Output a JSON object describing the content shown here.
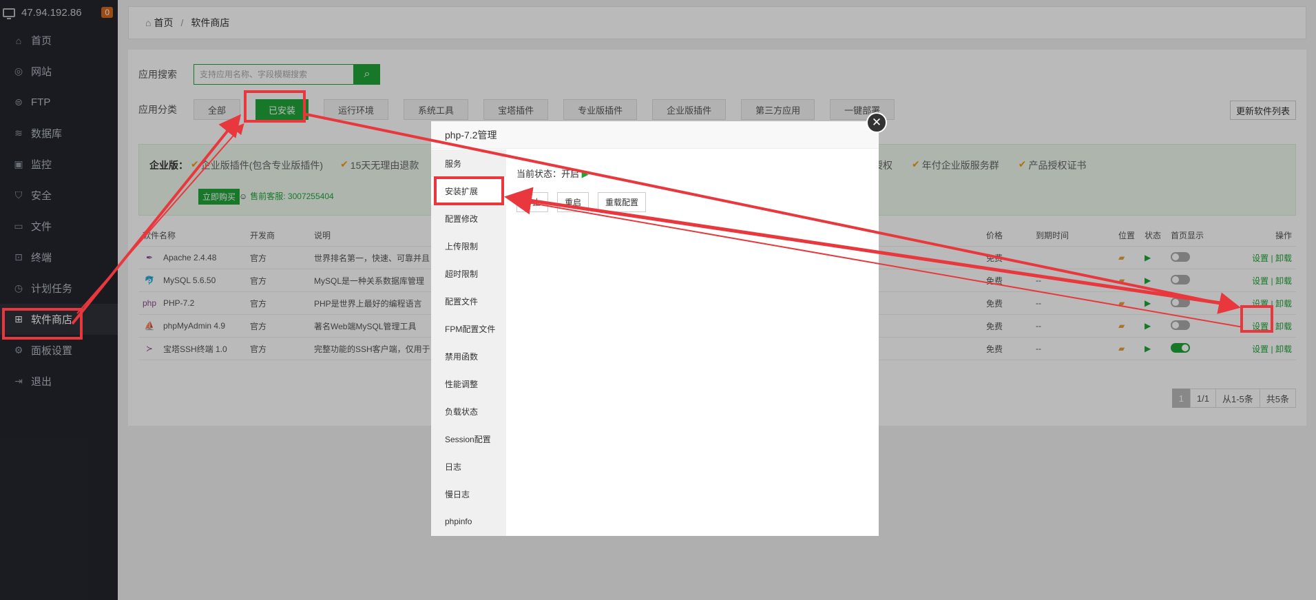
{
  "sidebar": {
    "ip": "47.94.192.86",
    "badge": "0",
    "items": [
      {
        "icon": "home-icon",
        "glyph": "⌂",
        "label": "首页"
      },
      {
        "icon": "globe-icon",
        "glyph": "◎",
        "label": "网站"
      },
      {
        "icon": "ftp-icon",
        "glyph": "⊜",
        "label": "FTP"
      },
      {
        "icon": "database-icon",
        "glyph": "≋",
        "label": "数据库"
      },
      {
        "icon": "monitor-icon",
        "glyph": "▣",
        "label": "监控"
      },
      {
        "icon": "shield-icon",
        "glyph": "⛉",
        "label": "安全"
      },
      {
        "icon": "folder-icon",
        "glyph": "▭",
        "label": "文件"
      },
      {
        "icon": "terminal-icon",
        "glyph": "⊡",
        "label": "终端"
      },
      {
        "icon": "clock-icon",
        "glyph": "◷",
        "label": "计划任务"
      },
      {
        "icon": "grid-icon",
        "glyph": "⊞",
        "label": "软件商店"
      },
      {
        "icon": "gear-icon",
        "glyph": "⚙",
        "label": "面板设置"
      },
      {
        "icon": "logout-icon",
        "glyph": "⇥",
        "label": "退出"
      }
    ]
  },
  "breadcrumb": {
    "home": "首页",
    "sep": "/",
    "current": "软件商店"
  },
  "search": {
    "label": "应用搜索",
    "placeholder": "支持应用名称、字段模糊搜索"
  },
  "categories": {
    "label": "应用分类",
    "items": [
      "全部",
      "已安装",
      "运行环境",
      "系统工具",
      "宝塔插件",
      "专业版插件",
      "企业版插件",
      "第三方应用",
      "一键部署"
    ],
    "update": "更新软件列表"
  },
  "enterprise": {
    "title": "企业版：",
    "feat1": "企业版插件(包含专业版插件)",
    "feat2": "15天无理由退款",
    "feat3": "授权",
    "feat4": "年付企业版服务群",
    "feat5": "产品授权证书",
    "buy": "立即购买",
    "service": "售前客服: 3007255404"
  },
  "table": {
    "headers": [
      "软件名称",
      "开发商",
      "说明",
      "价格",
      "到期时间",
      "位置",
      "状态",
      "首页显示",
      "操作"
    ],
    "rows": [
      {
        "name": "Apache 2.4.48",
        "dev": "官方",
        "desc": "世界排名第一，快速、可靠并且",
        "price": "免费",
        "expire": "",
        "show": false
      },
      {
        "name": "MySQL 5.6.50",
        "dev": "官方",
        "desc": "MySQL是一种关系数据库管理",
        "price": "免费",
        "expire": "--",
        "show": false
      },
      {
        "name": "PHP-7.2",
        "dev": "官方",
        "desc": "PHP是世界上最好的编程语言",
        "price": "免费",
        "expire": "--",
        "show": false
      },
      {
        "name": "phpMyAdmin 4.9",
        "dev": "官方",
        "desc": "著名Web端MySQL管理工具",
        "price": "免费",
        "expire": "--",
        "show": false
      },
      {
        "name": "宝塔SSH终端 1.0",
        "dev": "官方",
        "desc": "完整功能的SSH客户端，仅用于",
        "price": "免费",
        "expire": "--",
        "show": true
      }
    ],
    "ops": {
      "set": "设置",
      "sep": "|",
      "uninstall": "卸载"
    }
  },
  "pager": {
    "current": "1",
    "pages": "1/1",
    "range": "从1-5条",
    "total": "共5条"
  },
  "dialog": {
    "title": "php-7.2管理",
    "nav": [
      "服务",
      "安装扩展",
      "配置修改",
      "上传限制",
      "超时限制",
      "配置文件",
      "FPM配置文件",
      "禁用函数",
      "性能调整",
      "负载状态",
      "Session配置",
      "日志",
      "慢日志",
      "phpinfo"
    ],
    "status_label": "当前状态：开启",
    "buttons": [
      "停止",
      "重启",
      "重载配置"
    ]
  }
}
